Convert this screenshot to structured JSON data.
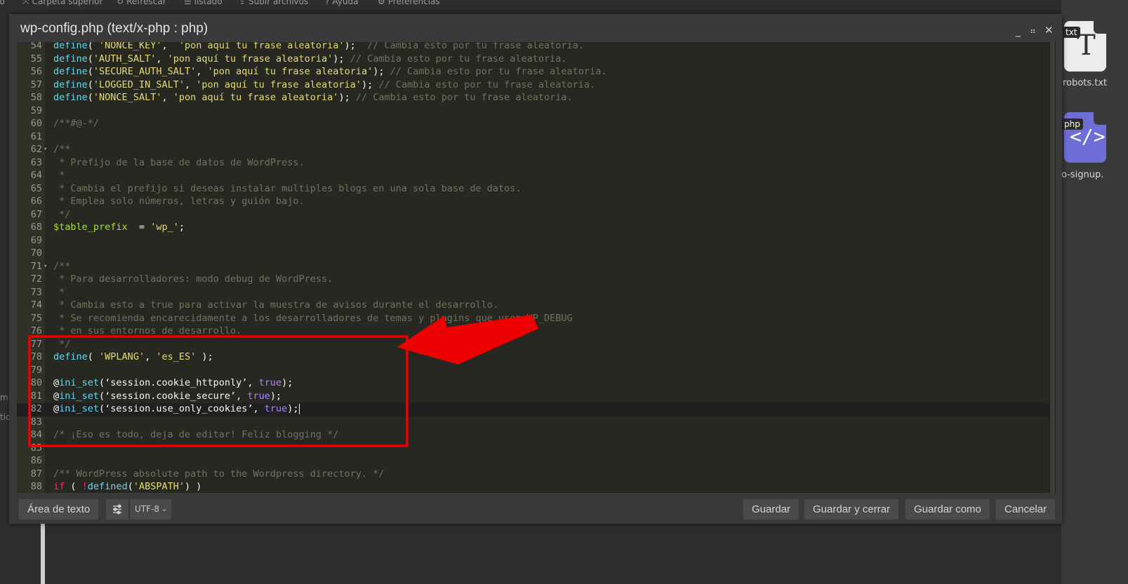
{
  "background": {
    "toolbar": [
      {
        "icon": "arrow-up-icon",
        "glyph": "⤧",
        "label": "Carpeta superior"
      },
      {
        "icon": "refresh-icon",
        "glyph": "↻",
        "label": "Refrescar"
      },
      {
        "icon": "list-icon",
        "glyph": "☰",
        "label": "listado"
      },
      {
        "icon": "upload-icon",
        "glyph": "⇪",
        "label": "Subir archivos"
      },
      {
        "icon": "help-icon",
        "glyph": "?",
        "label": "Ayuda"
      },
      {
        "icon": "settings-icon",
        "glyph": "⚙",
        "label": "Preferencias"
      }
    ],
    "left_fragments": [
      "io",
      "m",
      "tic"
    ],
    "files": [
      {
        "ext": "txt",
        "name": "robots.txt"
      },
      {
        "ext": "php",
        "name": "o-signup."
      }
    ]
  },
  "modal": {
    "title": "wp-config.php (text/x-php : php)",
    "minimize_glyph": "_",
    "maximize_glyph": "⠶",
    "close_glyph": "✕"
  },
  "editor": {
    "lines": [
      {
        "n": "54",
        "tokens": [
          [
            "kw",
            "define"
          ],
          [
            "",
            "( "
          ],
          [
            "str",
            "'NONCE_KEY'"
          ],
          [
            "",
            ",  "
          ],
          [
            "str",
            "'pon aquí tu frase aleatoria'"
          ],
          [
            "",
            ");  "
          ],
          [
            "cmt",
            "// Cambia esto por tu frase aleatoria."
          ]
        ]
      },
      {
        "n": "55",
        "tokens": [
          [
            "kw",
            "define"
          ],
          [
            "",
            "("
          ],
          [
            "str",
            "'AUTH_SALT'"
          ],
          [
            "",
            ", "
          ],
          [
            "str",
            "'pon aquí tu frase aleatoria'"
          ],
          [
            "",
            "); "
          ],
          [
            "cmt",
            "// Cambia esto por tu frase aleatoria."
          ]
        ]
      },
      {
        "n": "56",
        "tokens": [
          [
            "kw",
            "define"
          ],
          [
            "",
            "("
          ],
          [
            "str",
            "'SECURE_AUTH_SALT'"
          ],
          [
            "",
            ", "
          ],
          [
            "str",
            "'pon aquí tu frase aleatoria'"
          ],
          [
            "",
            "); "
          ],
          [
            "cmt",
            "// Cambia esto por tu frase aleatoria."
          ]
        ]
      },
      {
        "n": "57",
        "tokens": [
          [
            "kw",
            "define"
          ],
          [
            "",
            "("
          ],
          [
            "str",
            "'LOGGED_IN_SALT'"
          ],
          [
            "",
            ", "
          ],
          [
            "str",
            "'pon aquí tu frase aleatoria'"
          ],
          [
            "",
            "); "
          ],
          [
            "cmt",
            "// Cambia esto por tu frase aleatoria."
          ]
        ]
      },
      {
        "n": "58",
        "tokens": [
          [
            "kw",
            "define"
          ],
          [
            "",
            "("
          ],
          [
            "str",
            "'NONCE_SALT'"
          ],
          [
            "",
            ", "
          ],
          [
            "str",
            "'pon aquí tu frase aleatoria'"
          ],
          [
            "",
            "); "
          ],
          [
            "cmt",
            "// Cambia esto por tu frase aleatoria."
          ]
        ]
      },
      {
        "n": "59",
        "tokens": []
      },
      {
        "n": "60",
        "tokens": [
          [
            "cmt",
            "/**#@-*/"
          ]
        ]
      },
      {
        "n": "61",
        "tokens": []
      },
      {
        "n": "62",
        "fold": true,
        "tokens": [
          [
            "cmt",
            "/**"
          ]
        ]
      },
      {
        "n": "63",
        "tokens": [
          [
            "cmt",
            " * Prefijo de la base de datos de WordPress."
          ]
        ]
      },
      {
        "n": "64",
        "tokens": [
          [
            "cmt",
            " *"
          ]
        ]
      },
      {
        "n": "65",
        "tokens": [
          [
            "cmt",
            " * Cambia el prefijo si deseas instalar multiples blogs en una sola base de datos."
          ]
        ]
      },
      {
        "n": "66",
        "tokens": [
          [
            "cmt",
            " * Emplea solo números, letras y guión bajo."
          ]
        ]
      },
      {
        "n": "67",
        "tokens": [
          [
            "cmt",
            " */"
          ]
        ]
      },
      {
        "n": "68",
        "tokens": [
          [
            "var",
            "$table_prefix"
          ],
          [
            "",
            "  = "
          ],
          [
            "str",
            "'wp_'"
          ],
          [
            "",
            ";"
          ]
        ]
      },
      {
        "n": "69",
        "tokens": []
      },
      {
        "n": "70",
        "tokens": []
      },
      {
        "n": "71",
        "fold": true,
        "tokens": [
          [
            "cmt",
            "/**"
          ]
        ]
      },
      {
        "n": "72",
        "tokens": [
          [
            "cmt",
            " * Para desarrolladores: modo debug de WordPress."
          ]
        ]
      },
      {
        "n": "73",
        "tokens": [
          [
            "cmt",
            " *"
          ]
        ]
      },
      {
        "n": "74",
        "tokens": [
          [
            "cmt",
            " * Cambia esto a true para activar la muestra de avisos durante el desarrollo."
          ]
        ]
      },
      {
        "n": "75",
        "tokens": [
          [
            "cmt",
            " * Se recomienda encarecidamente a los desarrolladores de temas y plugins que usen WP_DEBUG"
          ]
        ]
      },
      {
        "n": "76",
        "tokens": [
          [
            "cmt",
            " * en sus entornos de desarrollo."
          ]
        ]
      },
      {
        "n": "77",
        "tokens": [
          [
            "cmt",
            " */"
          ]
        ]
      },
      {
        "n": "78",
        "tokens": [
          [
            "kw",
            "define"
          ],
          [
            "",
            "( "
          ],
          [
            "str",
            "'WPLANG'"
          ],
          [
            "",
            ", "
          ],
          [
            "str",
            "'es_ES'"
          ],
          [
            "",
            " );"
          ]
        ]
      },
      {
        "n": "79",
        "tokens": []
      },
      {
        "n": "80",
        "tokens": [
          [
            "",
            "@"
          ],
          [
            "kw",
            "ini_set"
          ],
          [
            "",
            "(‘session.cookie_httponly’, "
          ],
          [
            "bool",
            "true"
          ],
          [
            "",
            ");"
          ]
        ]
      },
      {
        "n": "81",
        "tokens": [
          [
            "",
            "@"
          ],
          [
            "kw",
            "ini_set"
          ],
          [
            "",
            "(‘session.cookie_secure’, "
          ],
          [
            "bool",
            "true"
          ],
          [
            "",
            ");"
          ]
        ]
      },
      {
        "n": "82",
        "cursor": true,
        "tokens": [
          [
            "",
            "@"
          ],
          [
            "kw",
            "ini_set"
          ],
          [
            "",
            "(‘session.use_only_cookies’, "
          ],
          [
            "bool",
            "true"
          ],
          [
            "",
            ");"
          ]
        ]
      },
      {
        "n": "83",
        "tokens": []
      },
      {
        "n": "84",
        "tokens": [
          [
            "cmt",
            "/* ¡Eso es todo, deja de editar! Feliz blogging */"
          ]
        ]
      },
      {
        "n": "85",
        "tokens": []
      },
      {
        "n": "86",
        "tokens": []
      },
      {
        "n": "87",
        "tokens": [
          [
            "cmt",
            "/** WordPress absolute path to the Wordpress directory. */"
          ]
        ]
      },
      {
        "n": "88",
        "tokens": [
          [
            "ctl",
            "if"
          ],
          [
            "",
            " ( "
          ],
          [
            "ctl",
            "!"
          ],
          [
            "kw",
            "defined"
          ],
          [
            "",
            "("
          ],
          [
            "str",
            "'ABSPATH'"
          ],
          [
            "",
            ") )"
          ]
        ]
      }
    ]
  },
  "footer": {
    "mode_button": "Área de texto",
    "settings_icon": "sliders-icon",
    "encoding": "UTF-8",
    "save": "Guardar",
    "save_close": "Guardar y cerrar",
    "save_as": "Guardar como",
    "cancel": "Cancelar"
  },
  "colors": {
    "keyword": "#66d9ef",
    "string": "#e6db74",
    "comment": "#75715e",
    "variable": "#a6e22e",
    "boolean": "#ae81ff",
    "control": "#f92672",
    "annotation": "#ee0000"
  }
}
